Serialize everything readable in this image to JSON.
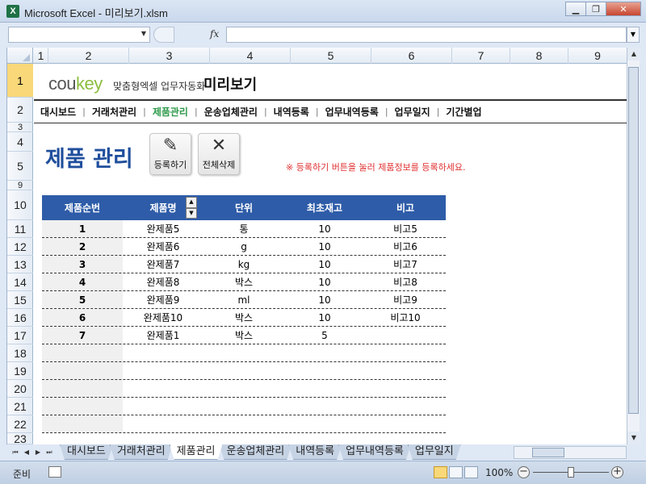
{
  "window": {
    "title": "Microsoft Excel - 미리보기.xlsm",
    "app_icon_glyph": "X"
  },
  "formula_bar": {
    "fx": "fx",
    "name_box": "",
    "formula": ""
  },
  "columns": [
    "1",
    "2",
    "3",
    "4",
    "5",
    "6",
    "7",
    "8",
    "9"
  ],
  "rows": [
    "1",
    "2",
    "3",
    "4",
    "5",
    "9",
    "10",
    "11",
    "12",
    "13",
    "14",
    "15",
    "16",
    "17",
    "18",
    "19",
    "20",
    "21",
    "22",
    "23"
  ],
  "header": {
    "logo_cou": "cou",
    "logo_key": "key",
    "logo_sub": "맞춤형엑셀 업무자동화",
    "page_name": "미리보기"
  },
  "nav": [
    "대시보드",
    "거래처관리",
    "제품관리",
    "운송업체관리",
    "내역등록",
    "업무내역등록",
    "업무일지",
    "기간별업"
  ],
  "nav_active": "제품관리",
  "section": {
    "title": "제품 관리",
    "register_label": "등록하기",
    "delete_all_label": "전체삭제",
    "notice": "※ 등록하기 버튼을 눌러 제품정보를 등록하세요."
  },
  "table": {
    "headers": [
      "제품순번",
      "제품명",
      "단위",
      "최초재고",
      "비고"
    ],
    "rows": [
      [
        "1",
        "완제품5",
        "통",
        "10",
        "비고5"
      ],
      [
        "2",
        "완제품6",
        "g",
        "10",
        "비고6"
      ],
      [
        "3",
        "완제품7",
        "kg",
        "10",
        "비고7"
      ],
      [
        "4",
        "완제품8",
        "박스",
        "10",
        "비고8"
      ],
      [
        "5",
        "완제품9",
        "ml",
        "10",
        "비고9"
      ],
      [
        "6",
        "완제품10",
        "박스",
        "10",
        "비고10"
      ],
      [
        "7",
        "완제품1",
        "박스",
        "5",
        ""
      ],
      [
        "",
        "",
        "",
        "",
        ""
      ],
      [
        "",
        "",
        "",
        "",
        ""
      ],
      [
        "",
        "",
        "",
        "",
        ""
      ],
      [
        "",
        "",
        "",
        "",
        ""
      ],
      [
        "",
        "",
        "",
        "",
        ""
      ]
    ]
  },
  "sheet_tabs": [
    "대시보드",
    "거래처관리",
    "제품관리",
    "운송업체관리",
    "내역등록",
    "업무내역등록",
    "업무일지"
  ],
  "active_tab": "제품관리",
  "status": {
    "ready": "준비",
    "zoom": "100%"
  },
  "colors": {
    "accent_blue": "#2e5ca8",
    "nav_active": "#2e9a4b",
    "notice_red": "#e03030",
    "logo_green": "#8cbe3f"
  }
}
